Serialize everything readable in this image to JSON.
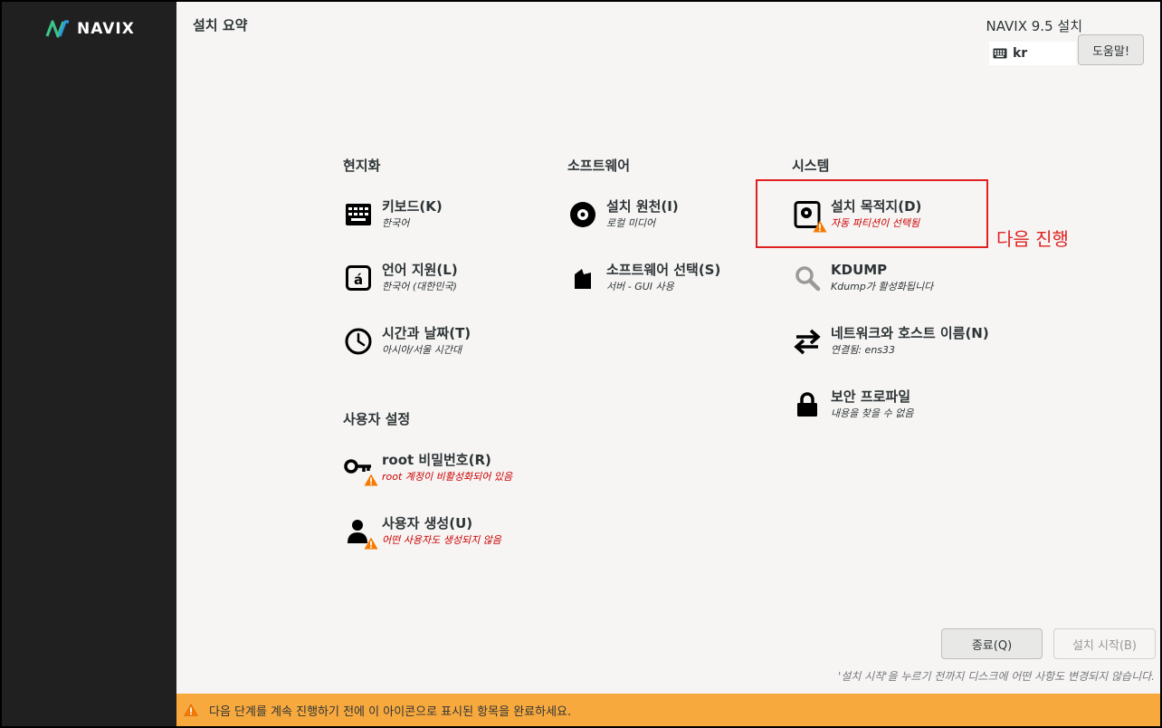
{
  "brand": {
    "name": "NAVIX",
    "accent": "#3ec48a"
  },
  "header": {
    "title": "설치 요약",
    "product": "NAVIX 9.5 설치",
    "keyboard_layout": "kr",
    "help_label": "도움말!"
  },
  "categories": {
    "localization": "현지화",
    "software": "소프트웨어",
    "system": "시스템",
    "user_settings": "사용자 설정"
  },
  "spokes": {
    "keyboard": {
      "title": "키보드(K)",
      "status": "한국어",
      "icon": "keyboard-icon",
      "warning": false
    },
    "language": {
      "title": "언어 지원(L)",
      "status": "한국어 (대한민국)",
      "icon": "language-icon",
      "warning": false
    },
    "datetime": {
      "title": "시간과 날짜(T)",
      "status": "아시아/서울 시간대",
      "icon": "clock-icon",
      "warning": false
    },
    "source": {
      "title": "설치 원천(I)",
      "status": "로컬 미디어",
      "icon": "disc-icon",
      "warning": false
    },
    "software": {
      "title": "소프트웨어 선택(S)",
      "status": "서버 - GUI 사용",
      "icon": "package-icon",
      "warning": false
    },
    "destination": {
      "title": "설치 목적지(D)",
      "status": "자동 파티션이 선택됨",
      "icon": "disk-icon",
      "warning": true
    },
    "kdump": {
      "title": "KDUMP",
      "status": "Kdump가 활성화됩니다",
      "icon": "magnifier-icon",
      "warning": false
    },
    "network": {
      "title": "네트워크와 호스트 이름(N)",
      "status": "연결됨: ens33",
      "icon": "network-arrows-icon",
      "warning": false
    },
    "security": {
      "title": "보안 프로파일",
      "status": "내용을 찾을 수 없음",
      "icon": "lock-icon",
      "warning": false
    },
    "root": {
      "title": "root 비밀번호(R)",
      "status": "root 계정이 비활성화되어 있음",
      "icon": "key-icon",
      "warning": true
    },
    "user": {
      "title": "사용자 생성(U)",
      "status": "어떤 사용자도 생성되지 않음",
      "icon": "user-icon",
      "warning": true
    }
  },
  "annotation": {
    "label": "다음 진행",
    "color": "#e02020"
  },
  "footer": {
    "quit_label": "종료(Q)",
    "begin_label": "설치 시작(B)",
    "note": "'설치 시작'을 누르기 전까지 디스크에 어떤 사항도 변경되지 않습니다.",
    "warning_text": "다음 단계를 계속 진행하기 전에 이 아이콘으로 표시된 항목을 완료하세요."
  },
  "colors": {
    "sidebar": "#202020",
    "background": "#f6f5f4",
    "warning_bar": "#f8a93e",
    "warning_text": "#cc0000"
  }
}
